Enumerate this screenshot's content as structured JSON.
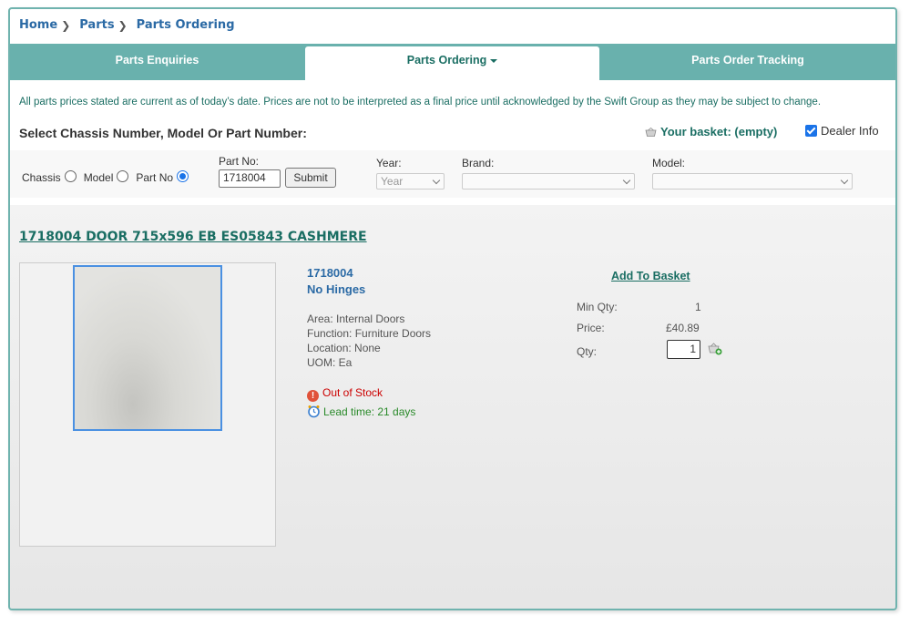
{
  "breadcrumb": {
    "items": [
      "Home",
      "Parts",
      "Parts Ordering"
    ]
  },
  "tabs": [
    {
      "label": "Parts Enquiries",
      "active": false
    },
    {
      "label": "Parts Ordering",
      "active": true
    },
    {
      "label": "Parts Order Tracking",
      "active": false
    }
  ],
  "notice": "All parts prices stated are current as of today’s date. Prices are not to be interpreted as a final price until acknowledged by the Swift Group as they may be subject to change.",
  "select_title": "Select Chassis Number, Model Or Part Number:",
  "basket": {
    "label": "Your basket: (empty)",
    "icon": "basket-icon"
  },
  "dealer_info": {
    "label": "Dealer Info",
    "checked": true
  },
  "filters": {
    "radio_options": [
      "Chassis",
      "Model",
      "Part No"
    ],
    "selected": "Part No",
    "part_no_label": "Part No:",
    "part_no_value": "1718004",
    "submit_label": "Submit",
    "year_label": "Year:",
    "year_value": "Year",
    "brand_label": "Brand:",
    "brand_value": "",
    "model_label": "Model:",
    "model_value": ""
  },
  "product": {
    "title": "1718004 DOOR 715x596 EB ES05843 CASHMERE",
    "part_number": "1718004",
    "subtitle": "No Hinges",
    "area": "Area: Internal Doors",
    "function": "Function: Furniture Doors",
    "location": "Location: None",
    "uom": "UOM: Ea",
    "stock_status": "Out of Stock",
    "lead_time": "Lead time: 21 days",
    "add_to_basket": "Add To Basket",
    "min_qty_label": "Min Qty:",
    "min_qty_value": "1",
    "price_label": "Price:",
    "price_value": "£40.89",
    "qty_label": "Qty:",
    "qty_value": "1"
  },
  "colors": {
    "teal": "#69b1ad",
    "link": "#2b6aa5",
    "dark_teal": "#1a6e63",
    "out_of_stock": "#cc0000",
    "lead_time": "#2a8a2a"
  }
}
